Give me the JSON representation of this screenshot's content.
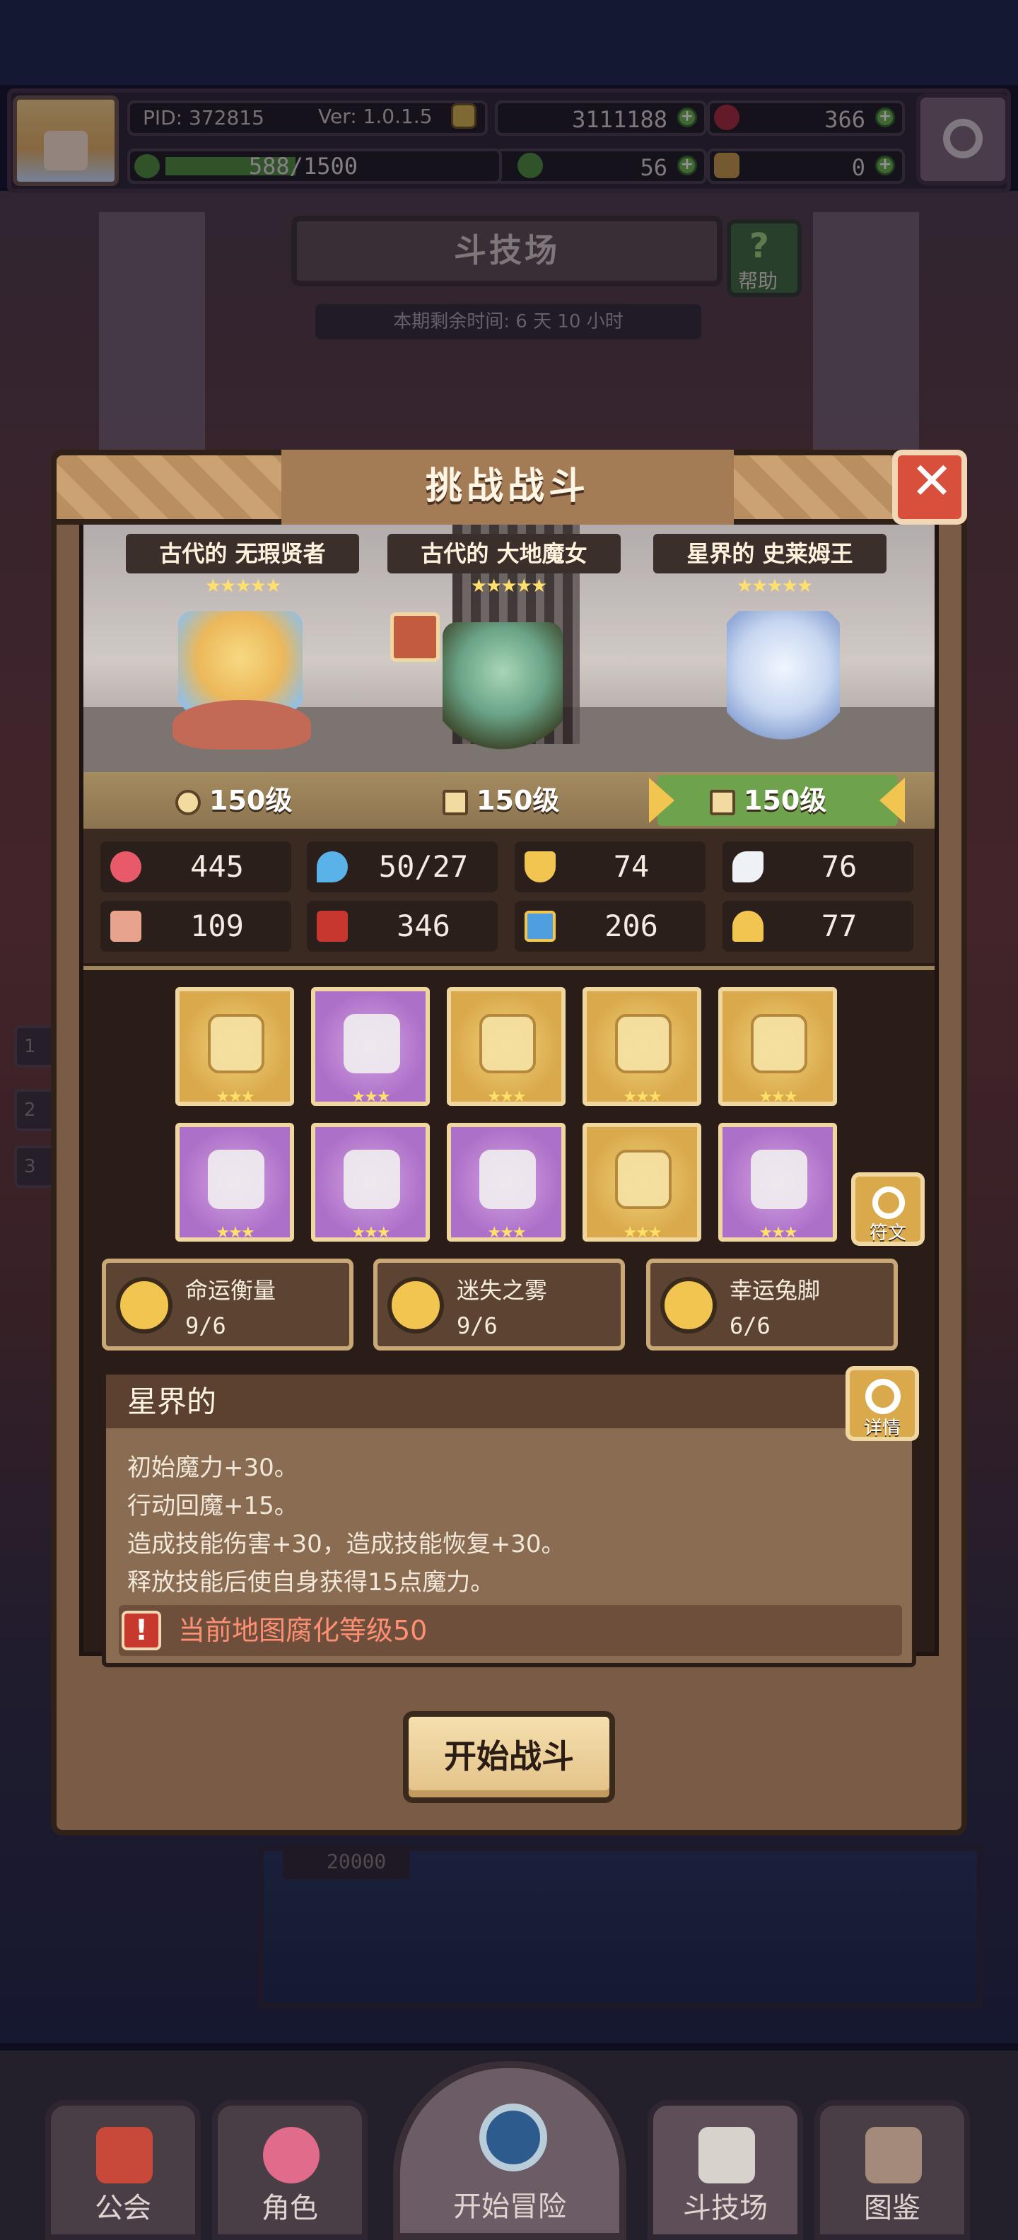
{
  "hud": {
    "pid": "PID: 372815",
    "version": "Ver: 1.0.1.5",
    "gold": "3111188",
    "gems": "366",
    "clovers": "56",
    "keys": "0",
    "exp_text": "588/1500",
    "exp_current": 588,
    "exp_max": 1500
  },
  "arena": {
    "title": "斗技场",
    "help_label": "帮助",
    "help_glyph": "?",
    "timer": "本期剩余时间:  6 天 10 小时",
    "side_tabs": [
      "1",
      "2",
      "3"
    ],
    "reward_amount": "20000"
  },
  "modal": {
    "title": "挑战战斗",
    "close_glyph": "✕",
    "heroes": [
      {
        "name": "古代的 无瑕贤者",
        "stars": "★★★★★",
        "level": "150级"
      },
      {
        "name": "古代的 大地魔女",
        "stars": "★★★★★",
        "level": "150级"
      },
      {
        "name": "星界的 史莱姆王",
        "stars": "★★★★★",
        "level": "150级"
      }
    ],
    "stats": [
      {
        "icon": "heart-icon",
        "value": "445"
      },
      {
        "icon": "mana-drop-icon",
        "value": "50/27"
      },
      {
        "icon": "shield-icon",
        "value": "74"
      },
      {
        "icon": "wing-icon",
        "value": "76"
      },
      {
        "icon": "fist-icon",
        "value": "109"
      },
      {
        "icon": "spellbook-icon",
        "value": "346"
      },
      {
        "icon": "scroll-icon",
        "value": "206"
      },
      {
        "icon": "horseshoe-icon",
        "value": "77"
      }
    ],
    "gear": [
      {
        "name": "scepter",
        "rarity": "gold",
        "stars": "★★★"
      },
      {
        "name": "pearl",
        "rarity": "purple",
        "stars": "★★★"
      },
      {
        "name": "necklace",
        "rarity": "gold",
        "stars": "★★★"
      },
      {
        "name": "emblem",
        "rarity": "gold",
        "stars": "★★★"
      },
      {
        "name": "ring",
        "rarity": "gold",
        "stars": "★★★"
      },
      {
        "name": "hat",
        "rarity": "purple",
        "stars": "★★★"
      },
      {
        "name": "armor",
        "rarity": "purple",
        "stars": "★★★"
      },
      {
        "name": "boot",
        "rarity": "purple",
        "stars": "★★★"
      },
      {
        "name": "bracelet",
        "rarity": "gold",
        "stars": "★★★"
      },
      {
        "name": "greaves",
        "rarity": "purple",
        "stars": "★★★"
      }
    ],
    "rune_label": "符文",
    "sets": [
      {
        "name": "命运衡量",
        "count": "9/6"
      },
      {
        "name": "迷失之雾",
        "count": "9/6"
      },
      {
        "name": "幸运兔脚",
        "count": "6/6"
      }
    ],
    "desc_title": "星界的",
    "detail_label": "详情",
    "desc_lines": [
      "初始魔力+30。",
      "行动回魔+15。",
      "造成技能伤害+30，造成技能恢复+30。",
      "释放技能后使自身获得15点魔力。"
    ],
    "warning_glyph": "!",
    "warning": "当前地图腐化等级50",
    "start_label": "开始战斗"
  },
  "nav": {
    "guild": "公会",
    "characters": "角色",
    "adventure": "开始冒险",
    "arena": "斗技场",
    "codex": "图鉴"
  },
  "colors": {
    "accent_gold": "#f2c450",
    "active_level": "#6fa24c",
    "warning": "#ff8f73",
    "close_red": "#d8503c",
    "gear_gold": "#d9a94b",
    "gear_purple": "#ad70c8"
  }
}
